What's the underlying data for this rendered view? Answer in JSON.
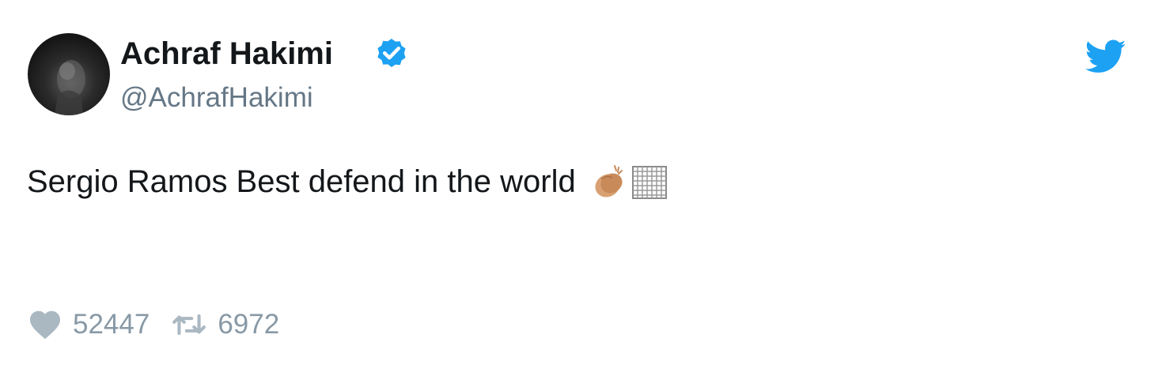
{
  "author": {
    "display_name": "Achraf Hakimi",
    "handle": "@AchrafHakimi",
    "verified": true
  },
  "tweet": {
    "text": "Sergio Ramos Best defend in the world",
    "emoji": [
      "clapping-hands",
      "flag-placeholder"
    ]
  },
  "stats": {
    "likes": "52447",
    "retweets": "6972"
  },
  "colors": {
    "twitter_blue": "#1da1f2",
    "text_primary": "#14171a",
    "text_secondary": "#657786",
    "action_gray": "#8899a6"
  },
  "icons": {
    "verified": "verified-badge-icon",
    "brand": "twitter-bird-icon",
    "like": "heart-icon",
    "retweet": "retweet-icon"
  }
}
